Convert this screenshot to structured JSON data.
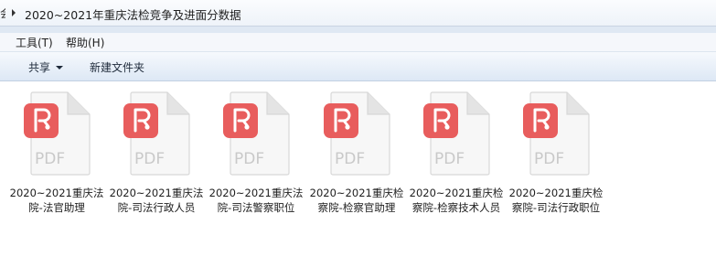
{
  "address": {
    "prev_fragment": "会",
    "path": "2020~2021年重庆法检竞争及进面分数据"
  },
  "menu": {
    "tools": "工具(T)",
    "help": "帮助(H)"
  },
  "toolbar": {
    "share": "共享",
    "new_folder": "新建文件夹"
  },
  "files": [
    {
      "name": "2020~2021重庆法院-法官助理",
      "type_label": "PDF",
      "icon": "pdf-file-icon"
    },
    {
      "name": "2020~2021重庆法院-司法行政人员",
      "type_label": "PDF",
      "icon": "pdf-file-icon"
    },
    {
      "name": "2020~2021重庆法院-司法警察职位",
      "type_label": "PDF",
      "icon": "pdf-file-icon"
    },
    {
      "name": "2020~2021重庆检察院-检察官助理",
      "type_label": "PDF",
      "icon": "pdf-file-icon"
    },
    {
      "name": "2020~2021重庆检察院-检察技术人员",
      "type_label": "PDF",
      "icon": "pdf-file-icon"
    },
    {
      "name": "2020~2021重庆检察院-司法行政职位",
      "type_label": "PDF",
      "icon": "pdf-file-icon"
    }
  ],
  "colors": {
    "pdf_badge": "#e85d5d",
    "page": "#f7f7f7",
    "pdf_text": "#c9c9c9"
  }
}
